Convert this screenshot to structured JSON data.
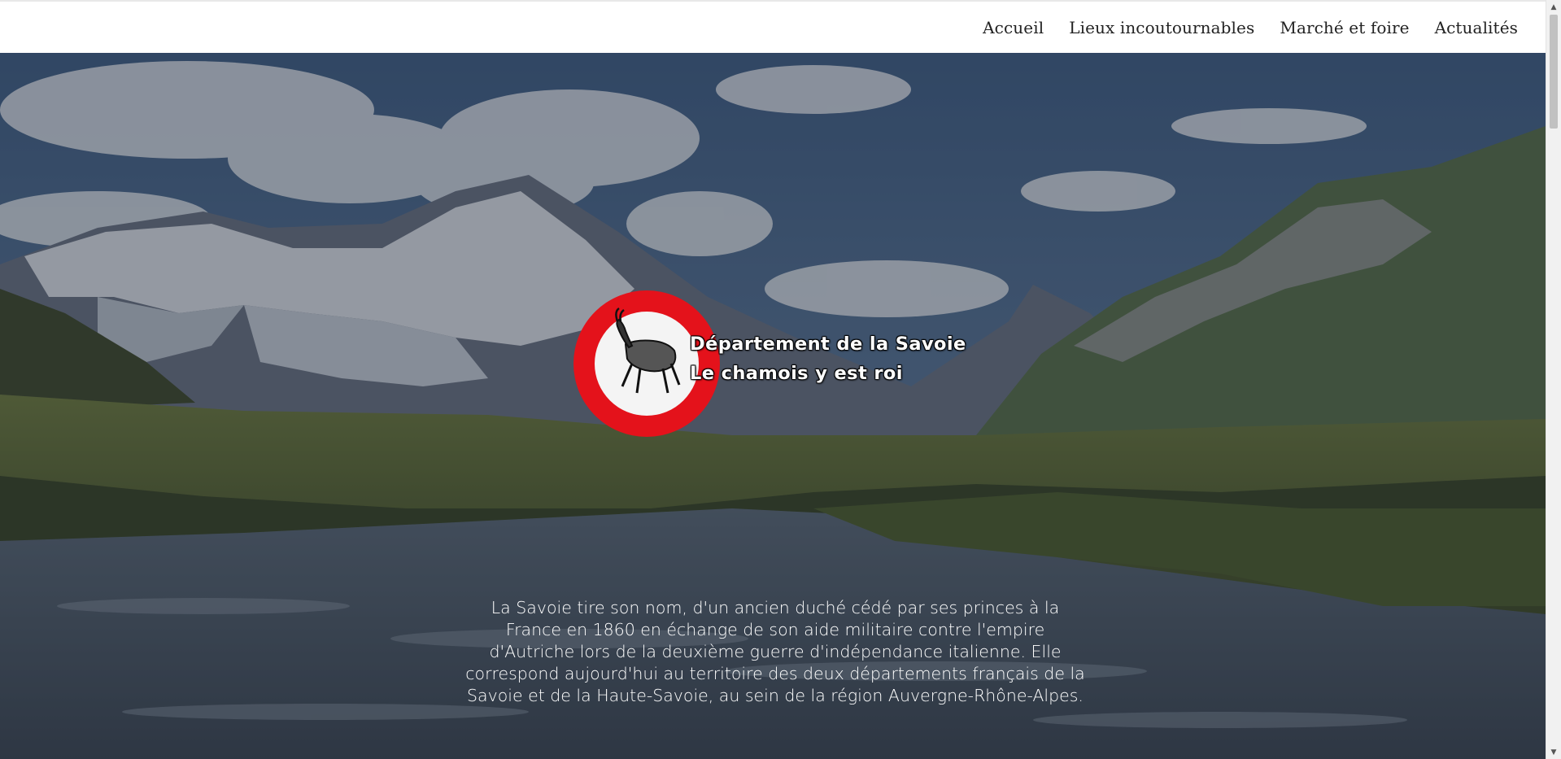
{
  "nav": {
    "items": [
      {
        "label": "Accueil"
      },
      {
        "label": "Lieux incoutournables"
      },
      {
        "label": "Marché et foire"
      },
      {
        "label": "Actualités"
      }
    ]
  },
  "hero": {
    "title_line1": "Département de la Savoie",
    "title_line2": "Le chamois y est roi",
    "description": "La Savoie tire son nom, d'un ancien duché cédé par ses princes à la France en 1860 en échange de son aide militaire contre l'empire d'Autriche lors de la deuxième guerre d'indépendance italienne. Elle correspond aujourd'hui au territoire des deux départements français de la Savoie et de la Haute-Savoie, au sein de la région Auvergne-Rhône-Alpes.",
    "logo_icon": "chamois-icon",
    "background_image": "mountain-valley-landscape"
  },
  "colors": {
    "logo_red": "#e4121b",
    "overlay": "rgba(25,32,45,0.38)",
    "nav_text": "#222222"
  },
  "scrollbar": {
    "up_icon": "▲",
    "down_icon": "▼"
  }
}
